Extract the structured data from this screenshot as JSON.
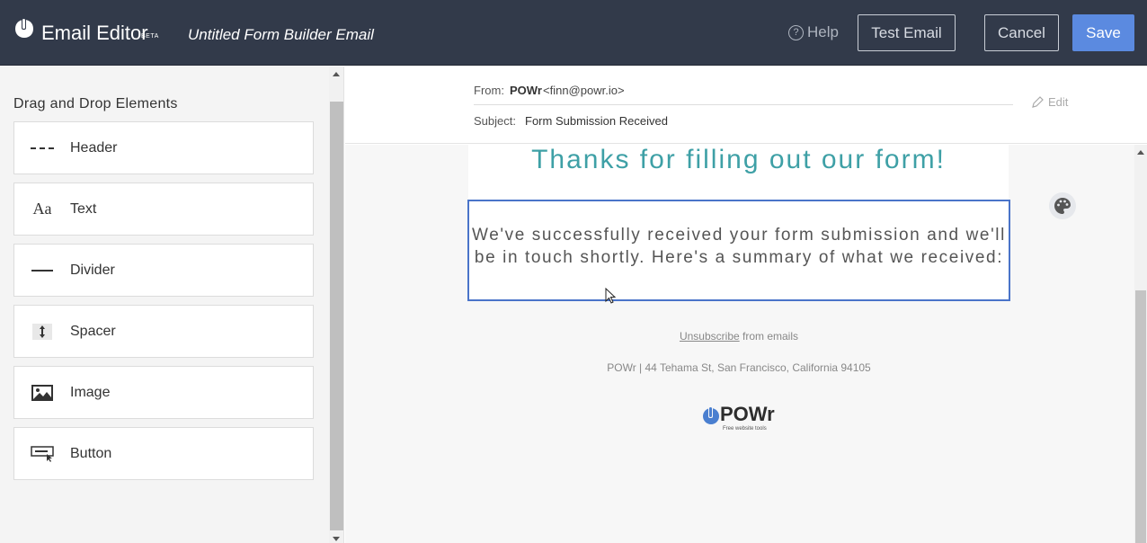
{
  "app": {
    "title": "Email Editor",
    "badge": "BETA",
    "doc_title": "Untitled Form Builder Email"
  },
  "toolbar": {
    "help_label": "Help",
    "test_label": "Test Email",
    "cancel_label": "Cancel",
    "save_label": "Save"
  },
  "sidebar": {
    "title": "Drag and Drop Elements",
    "items": [
      {
        "label": "Header",
        "icon": "header-dashes-icon"
      },
      {
        "label": "Text",
        "icon": "text-aa-icon"
      },
      {
        "label": "Divider",
        "icon": "divider-line-icon"
      },
      {
        "label": "Spacer",
        "icon": "spacer-arrows-icon"
      },
      {
        "label": "Image",
        "icon": "image-icon"
      },
      {
        "label": "Button",
        "icon": "button-icon"
      }
    ]
  },
  "email": {
    "from_label": "From:",
    "from_name": "POWr",
    "from_email": "<finn@powr.io>",
    "subject_label": "Subject:",
    "subject_value": "Form Submission Received",
    "edit_label": "Edit",
    "heading": "Thanks for filling out our form!",
    "body_line1": "We've successfully received your form submission and we'll",
    "body_line2": "be in touch shortly. Here's a summary of what we received:",
    "unsubscribe_link": "Unsubscribe",
    "unsubscribe_rest": " from emails",
    "address": "POWr | 44 Tehama St, San Francisco, California 94105",
    "logo_word": "POWr",
    "logo_tagline": "Free website tools"
  },
  "colors": {
    "topbar": "#323a4a",
    "accent": "#5b8ae0",
    "heading": "#3ea0a6",
    "selection": "#4a74c9"
  }
}
